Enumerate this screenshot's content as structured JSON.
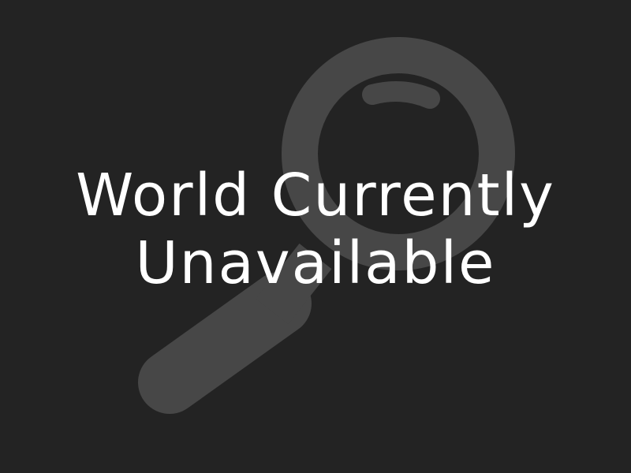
{
  "icon": {
    "name": "magnifier-icon",
    "color": "#474747"
  },
  "background_color": "#232323",
  "message": {
    "line1": "World Currently",
    "line2": "Unavailable",
    "color": "#ffffff"
  }
}
